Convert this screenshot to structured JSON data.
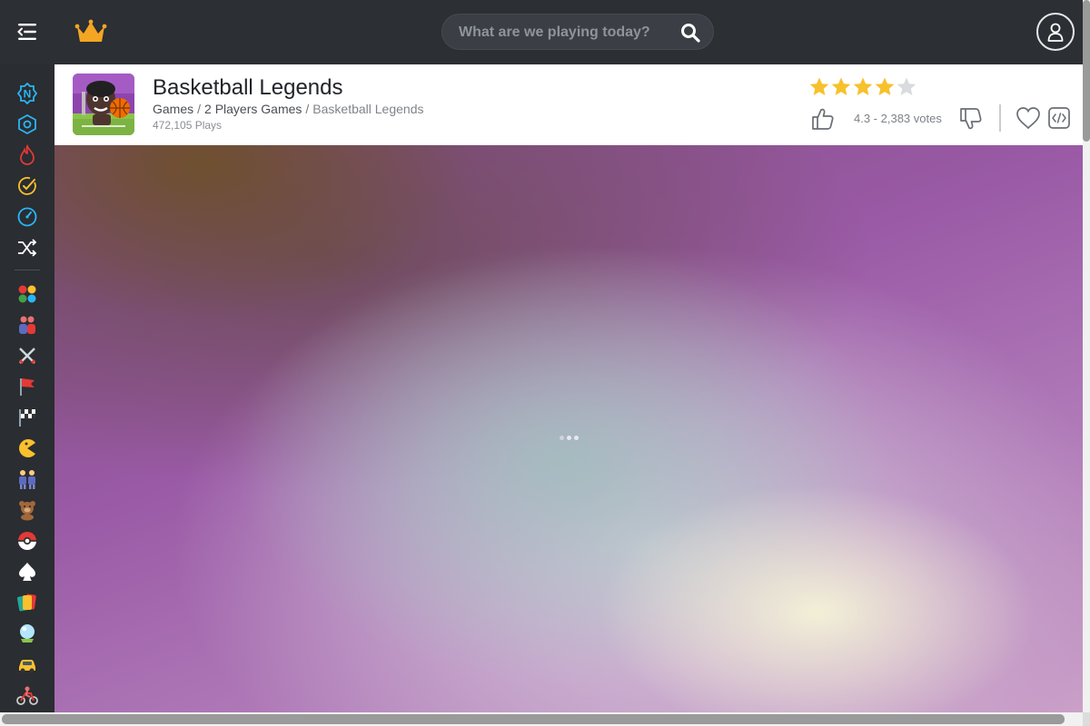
{
  "header": {
    "search_placeholder": "What are we playing today?"
  },
  "sidebar": {
    "items": [
      {
        "icon": "new-icon"
      },
      {
        "icon": "cube-icon"
      },
      {
        "icon": "fire-icon"
      },
      {
        "icon": "check-clock-icon"
      },
      {
        "icon": "speed-dial-icon"
      },
      {
        "icon": "shuffle-icon"
      }
    ],
    "categories": [
      {
        "icon": "dots-icon"
      },
      {
        "icon": "two-players-icon"
      },
      {
        "icon": "swords-icon"
      },
      {
        "icon": "flag-icon"
      },
      {
        "icon": "checkered-flag-icon"
      },
      {
        "icon": "pacman-icon"
      },
      {
        "icon": "people-icon"
      },
      {
        "icon": "teddy-bear-icon"
      },
      {
        "icon": "pokeball-icon"
      },
      {
        "icon": "spade-icon"
      },
      {
        "icon": "cards-icon"
      },
      {
        "icon": "crystal-ball-icon"
      },
      {
        "icon": "car-icon"
      },
      {
        "icon": "bike-icon"
      }
    ]
  },
  "game": {
    "title": "Basketball Legends",
    "breadcrumbs": {
      "root": "Games",
      "category": "2 Players Games",
      "current": "Basketball Legends",
      "separator": "/"
    },
    "plays": "472,105 Plays",
    "rating": 4.3,
    "votes_text": "4.3 - 2,383 votes",
    "stars_filled": 4,
    "stars_total": 5
  },
  "colors": {
    "accent_star": "#f7c12c",
    "star_empty": "#d9dbde",
    "logo": "#f4a623",
    "topbar": "#2c2f33"
  }
}
